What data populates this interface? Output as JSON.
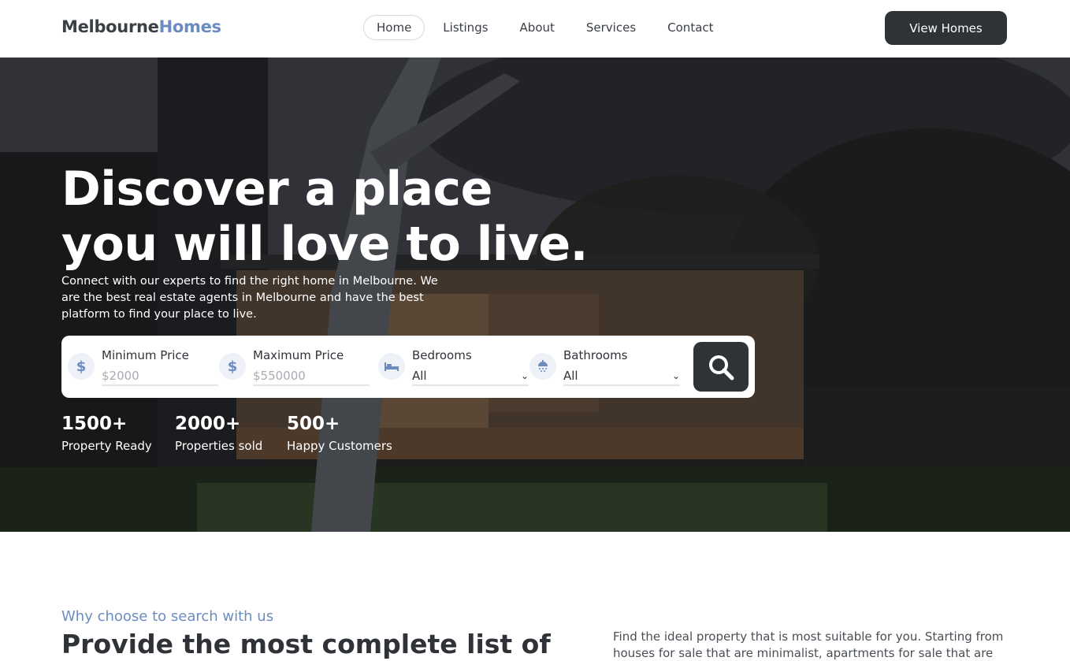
{
  "brand": {
    "part1": "Melbourne",
    "part2": "Homes"
  },
  "nav": {
    "items": [
      {
        "label": "Home",
        "active": true
      },
      {
        "label": "Listings",
        "active": false
      },
      {
        "label": "About",
        "active": false
      },
      {
        "label": "Services",
        "active": false
      },
      {
        "label": "Contact",
        "active": false
      }
    ],
    "cta_label": "View Homes"
  },
  "hero": {
    "title_line1": "Discover a place",
    "title_line2": "you will love to live.",
    "subtitle": "Connect with our experts to find the right home in Melbourne. We are the best real estate agents in Melbourne and have the best platform to find your place to live."
  },
  "search": {
    "min_price": {
      "label": "Minimum Price",
      "placeholder": "$2000",
      "icon": "dollar-icon"
    },
    "max_price": {
      "label": "Maximum Price",
      "placeholder": "$550000",
      "icon": "dollar-icon"
    },
    "bedrooms": {
      "label": "Bedrooms",
      "value": "All",
      "icon": "bed-icon"
    },
    "bathrooms": {
      "label": "Bathrooms",
      "value": "All",
      "icon": "shower-icon"
    },
    "button_icon": "search-icon"
  },
  "stats": [
    {
      "value": "1500+",
      "label": "Property Ready"
    },
    {
      "value": "2000+",
      "label": "Properties sold"
    },
    {
      "value": "500+",
      "label": "Happy Customers"
    }
  ],
  "section": {
    "eyebrow": "Why choose to search with us",
    "heading": "Provide the most complete list of",
    "body": "Find the ideal property that is most suitable for you. Starting from houses for sale that are minimalist, apartments for sale that are"
  },
  "colors": {
    "accent": "#6c8cbf",
    "dark": "#2f3237"
  }
}
